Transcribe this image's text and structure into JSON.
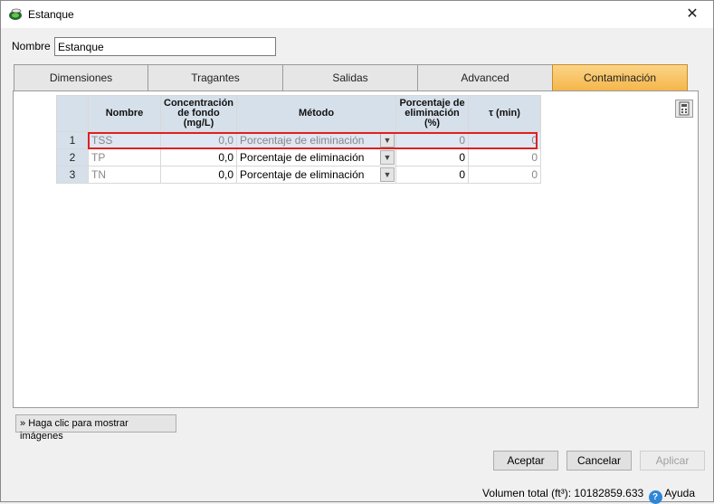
{
  "window": {
    "title": "Estanque",
    "close_glyph": "✕"
  },
  "name_field": {
    "label": "Nombre",
    "value": "Estanque"
  },
  "tabs": [
    {
      "label": "Dimensiones",
      "active": false
    },
    {
      "label": "Tragantes",
      "active": false
    },
    {
      "label": "Salidas",
      "active": false
    },
    {
      "label": "Advanced",
      "active": false
    },
    {
      "label": "Contaminación",
      "active": true
    }
  ],
  "grid": {
    "headers": {
      "nombre": "Nombre",
      "concentracion": "Concentración de fondo (mg/L)",
      "metodo": "Método",
      "porcentaje": "Porcentaje de eliminación (%)",
      "tau": "τ (min)"
    },
    "rows": [
      {
        "index": "1",
        "nombre": "TSS",
        "concentracion": "0,0",
        "metodo": "Porcentaje de eliminación",
        "porcentaje": "0",
        "tau": "0",
        "selected": true
      },
      {
        "index": "2",
        "nombre": "TP",
        "concentracion": "0,0",
        "metodo": "Porcentaje de eliminación",
        "porcentaje": "0",
        "tau": "0",
        "selected": false
      },
      {
        "index": "3",
        "nombre": "TN",
        "concentracion": "0,0",
        "metodo": "Porcentaje de eliminación",
        "porcentaje": "0",
        "tau": "0",
        "selected": false
      }
    ]
  },
  "show_images_button": "Haga clic para mostrar imágenes",
  "buttons": {
    "accept": "Aceptar",
    "cancel": "Cancelar",
    "apply": "Aplicar"
  },
  "status": {
    "volume": "Volumen total (ft³): 10182859.633",
    "help": "Ayuda"
  },
  "colors": {
    "active_tab": "#f5b64a",
    "selection_outline": "#e02020",
    "header_bg": "#d6e0ea"
  }
}
